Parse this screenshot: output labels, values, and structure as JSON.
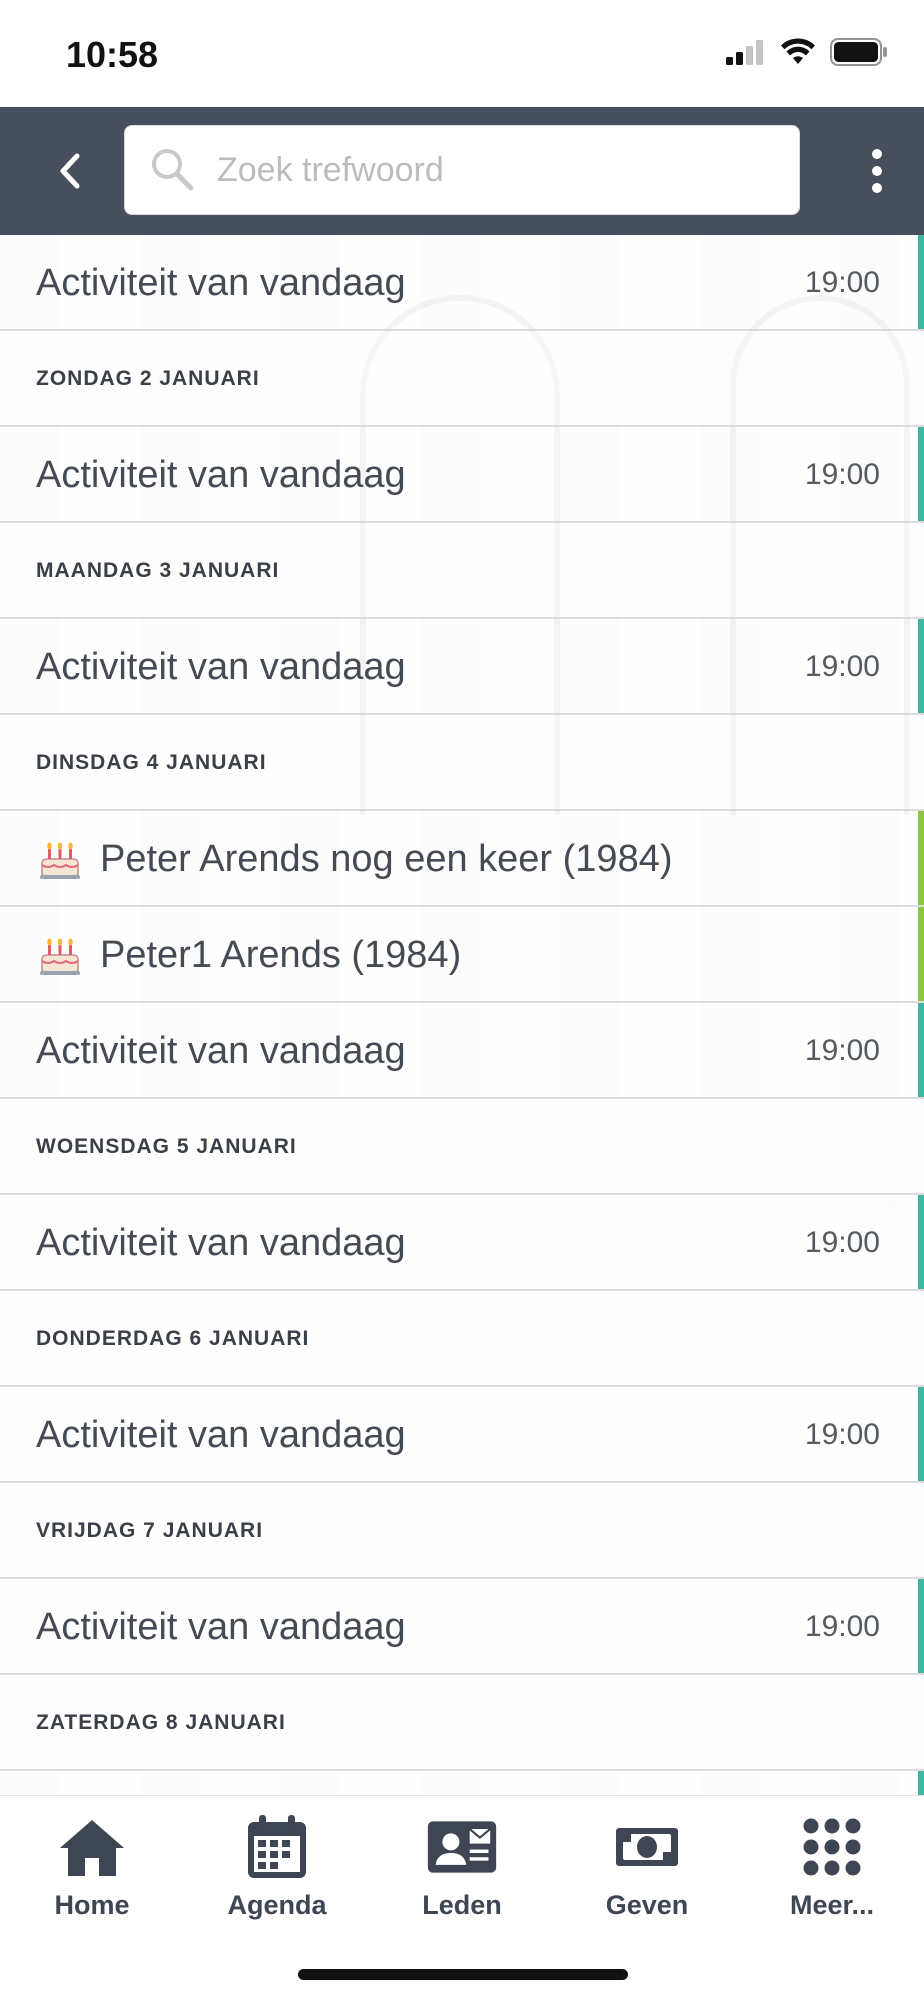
{
  "status_bar": {
    "time": "10:58"
  },
  "header": {
    "search_placeholder": "Zoek trefwoord"
  },
  "colors": {
    "header_bg": "#474e5c",
    "accent_event": "#3cb7a3",
    "accent_birthday": "#8cc63f"
  },
  "rows": [
    {
      "kind": "item",
      "title": "Activiteit van vandaag",
      "time": "19:00",
      "accent": "event"
    },
    {
      "kind": "section",
      "title": "ZONDAG 2 JANUARI"
    },
    {
      "kind": "item",
      "title": "Activiteit van vandaag",
      "time": "19:00",
      "accent": "event"
    },
    {
      "kind": "section",
      "title": "MAANDAG 3 JANUARI"
    },
    {
      "kind": "item",
      "title": "Activiteit van vandaag",
      "time": "19:00",
      "accent": "event"
    },
    {
      "kind": "section",
      "title": "DINSDAG 4 JANUARI"
    },
    {
      "kind": "birthday",
      "title": "Peter Arends nog een keer (1984)",
      "accent": "birthday"
    },
    {
      "kind": "birthday",
      "title": "Peter1 Arends (1984)",
      "accent": "birthday"
    },
    {
      "kind": "item",
      "title": "Activiteit van vandaag",
      "time": "19:00",
      "accent": "event"
    },
    {
      "kind": "section",
      "title": "WOENSDAG 5 JANUARI"
    },
    {
      "kind": "item",
      "title": "Activiteit van vandaag",
      "time": "19:00",
      "accent": "event"
    },
    {
      "kind": "section",
      "title": "DONDERDAG 6 JANUARI"
    },
    {
      "kind": "item",
      "title": "Activiteit van vandaag",
      "time": "19:00",
      "accent": "event"
    },
    {
      "kind": "section",
      "title": "VRIJDAG 7 JANUARI"
    },
    {
      "kind": "item",
      "title": "Activiteit van vandaag",
      "time": "19:00",
      "accent": "event"
    },
    {
      "kind": "section",
      "title": "ZATERDAG 8 JANUARI"
    }
  ],
  "tabs": {
    "home": {
      "label": "Home",
      "icon": "home-icon"
    },
    "agenda": {
      "label": "Agenda",
      "icon": "calendar-icon"
    },
    "leden": {
      "label": "Leden",
      "icon": "contact-card-icon"
    },
    "geven": {
      "label": "Geven",
      "icon": "money-icon"
    },
    "meer": {
      "label": "Meer...",
      "icon": "grid-dots-icon"
    }
  }
}
